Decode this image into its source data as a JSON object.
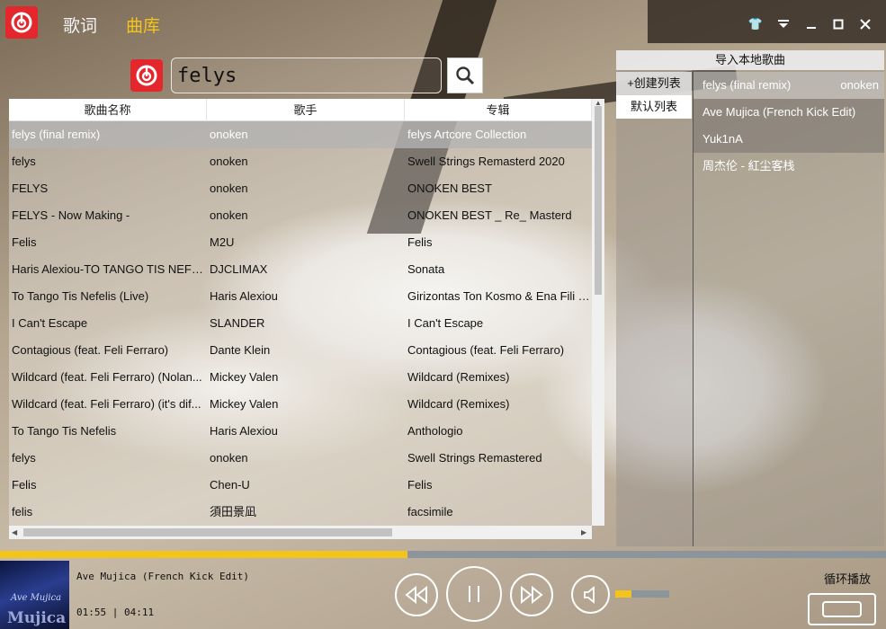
{
  "header": {
    "tabs": [
      {
        "label": "歌词",
        "color": "#f3f3f3"
      },
      {
        "label": "曲库",
        "color": "#f5c41a"
      }
    ],
    "window_buttons": [
      "shirt-icon",
      "menu-down-icon",
      "minimize-icon",
      "maximize-icon",
      "close-icon"
    ]
  },
  "search": {
    "query": "felys",
    "icon": "search-icon"
  },
  "results": {
    "columns": [
      "歌曲名称",
      "歌手",
      "专辑"
    ],
    "rows": [
      {
        "title": "felys (final remix)",
        "artist": "onoken",
        "album": "felys Artcore Collection"
      },
      {
        "title": "felys",
        "artist": "onoken",
        "album": "Swell Strings Remasterd 2020"
      },
      {
        "title": "FELYS",
        "artist": "onoken",
        "album": "ONOKEN BEST"
      },
      {
        "title": "FELYS - Now Making -",
        "artist": "onoken",
        "album": "ONOKEN BEST _ Re_ Masterd"
      },
      {
        "title": "Felis",
        "artist": "M2U",
        "album": "Felis"
      },
      {
        "title": "Haris Alexiou-TO TANGO TIS NEFE...",
        "artist": "DJCLIMAX",
        "album": "Sonata"
      },
      {
        "title": "To Tango Tis Nefelis (Live)",
        "artist": "Haris Alexiou",
        "album": "Girizontas Ton Kosmo & Ena Fili T..."
      },
      {
        "title": "I Can't Escape",
        "artist": "SLANDER",
        "album": "I Can't Escape"
      },
      {
        "title": "Contagious (feat. Feli Ferraro)",
        "artist": "Dante Klein",
        "album": "Contagious (feat. Feli Ferraro)"
      },
      {
        "title": "Wildcard (feat. Feli Ferraro) (Nolan...",
        "artist": "Mickey Valen",
        "album": "Wildcard (Remixes)"
      },
      {
        "title": "Wildcard (feat. Feli Ferraro) (it's dif...",
        "artist": "Mickey Valen",
        "album": "Wildcard (Remixes)"
      },
      {
        "title": "To Tango Tis Nefelis",
        "artist": "Haris Alexiou",
        "album": "Anthologio"
      },
      {
        "title": "felys",
        "artist": "onoken",
        "album": "Swell Strings Remastered"
      },
      {
        "title": "Felis",
        "artist": "Chen-U",
        "album": "Felis"
      },
      {
        "title": "felis",
        "artist": "須田景凪",
        "album": "facsimile"
      }
    ]
  },
  "playlist_panel": {
    "import_label": "导入本地歌曲",
    "create_label": "+创建列表",
    "default_label": "默认列表",
    "songs": [
      {
        "title": "felys (final remix)",
        "artist": "onoken"
      },
      {
        "title": "Ave Mujica (French Kick Edit)",
        "artist": ""
      },
      {
        "title": "Yuk1nA",
        "artist": ""
      },
      {
        "title": "周杰伦 - 紅尘客栈",
        "artist": ""
      }
    ]
  },
  "player": {
    "now_playing": "Ave Mujica (French Kick Edit)",
    "current_time": "01:55",
    "total_time": "04:11",
    "progress": 0.46,
    "volume": 0.3,
    "loop_mode": "循环播放",
    "cover_text_1": "Ave Mujica",
    "cover_text_2": "Mujica",
    "accent_color": "#f5c41a",
    "brand_color": "#e3272c"
  }
}
